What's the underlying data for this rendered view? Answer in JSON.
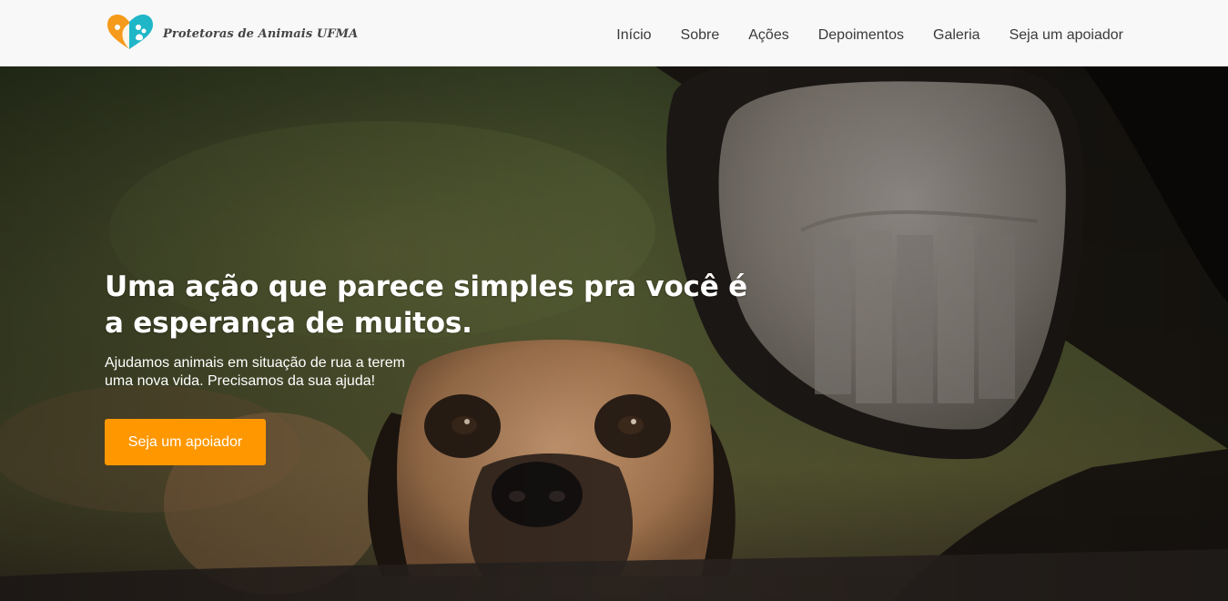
{
  "brand": {
    "name": "Protetoras de Animais UFMA",
    "logo_colors": {
      "left": "#f59a1b",
      "right": "#1fb6c8"
    }
  },
  "nav": {
    "items": [
      "Início",
      "Sobre",
      "Ações",
      "Depoimentos",
      "Galeria",
      "Seja um apoiador"
    ]
  },
  "hero": {
    "title_line1": "Uma ação que parece simples pra você é",
    "title_line2": "a esperança de muitos.",
    "subtitle": "Ajudamos animais em situação de rua a terem uma nova vida. Precisamos da sua ajuda!",
    "cta_label": "Seja um apoiador",
    "cta_color": "#ff9800"
  }
}
